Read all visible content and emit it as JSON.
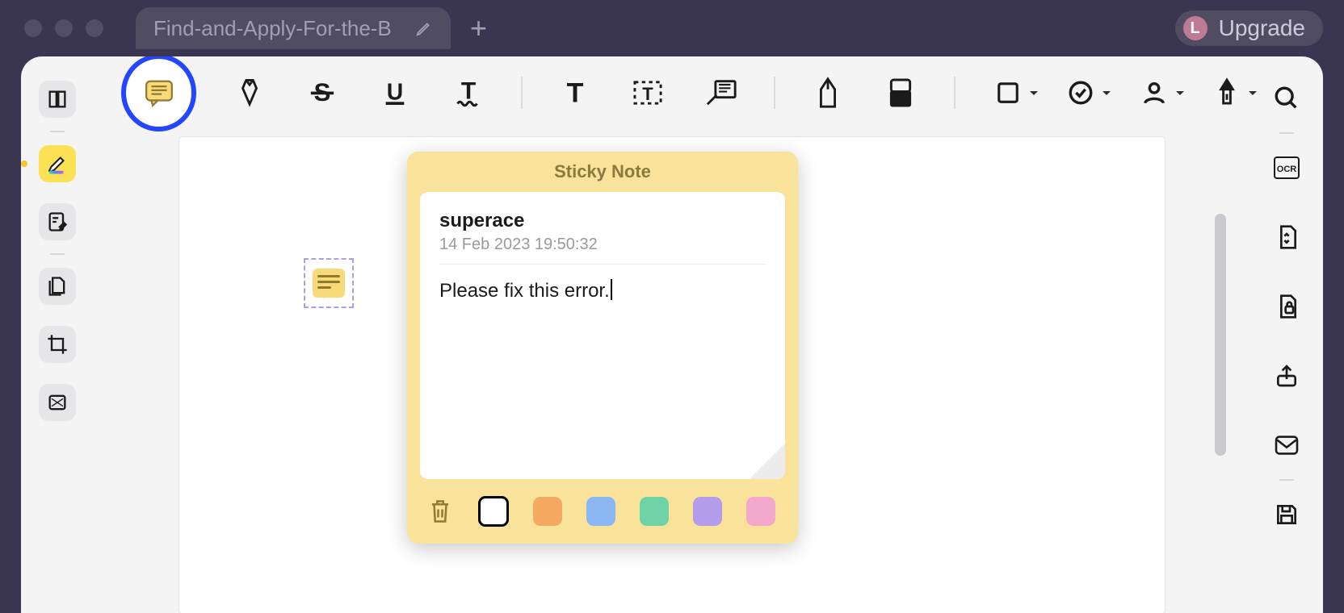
{
  "title_bar": {
    "tab_title": "Find-and-Apply-For-the-B",
    "upgrade_label": "Upgrade",
    "user_initial": "L"
  },
  "sticky": {
    "header": "Sticky Note",
    "user": "superace",
    "timestamp": "14 Feb 2023 19:50:32",
    "content": "Please fix this error.",
    "colors": {
      "orange": "#f6aa61",
      "blue": "#8bb8f2",
      "green": "#6ed2a4",
      "purple": "#b49cea",
      "pink": "#f3a7cb"
    }
  }
}
